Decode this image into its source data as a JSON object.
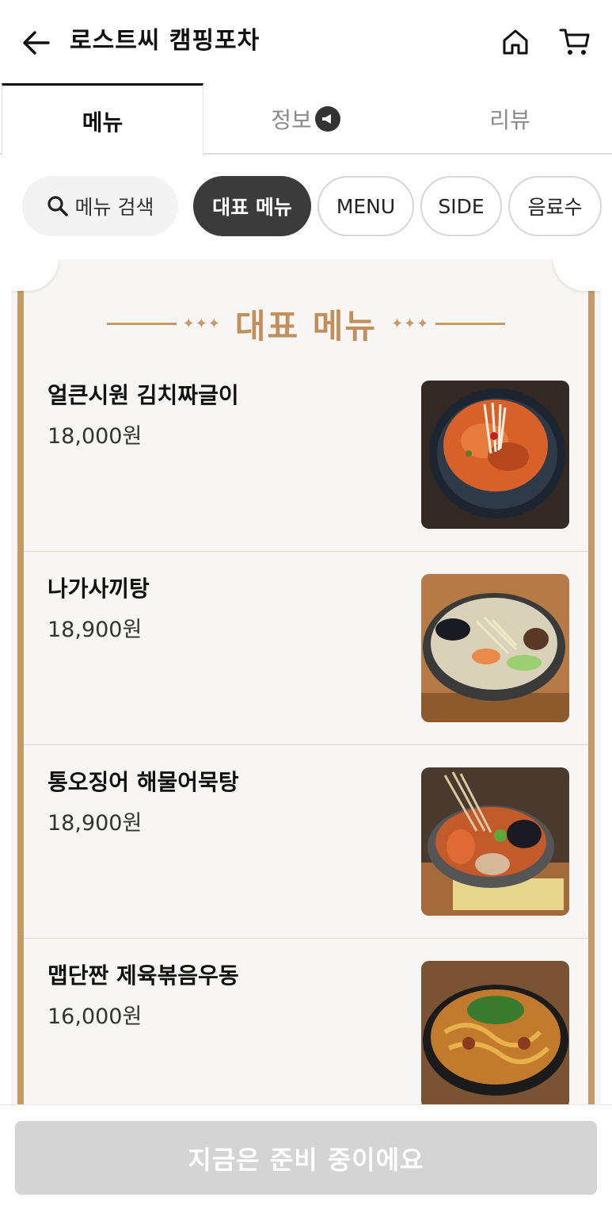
{
  "header": {
    "title": "로스트씨 캠핑포차"
  },
  "tabs": [
    {
      "label": "메뉴",
      "active": true
    },
    {
      "label": "정보",
      "active": false
    },
    {
      "label": "리뷰",
      "active": false
    }
  ],
  "chips": {
    "search_label": "메뉴 검색",
    "items": [
      {
        "label": "대표 메뉴",
        "active": true
      },
      {
        "label": "MENU",
        "active": false
      },
      {
        "label": "SIDE",
        "active": false
      },
      {
        "label": "음료수",
        "active": false
      }
    ]
  },
  "board": {
    "title": "대표 메뉴",
    "deco_left": "✦✦✦",
    "deco_right": "✦✦✦"
  },
  "menu_items": [
    {
      "name": "얼큰시원 김치짜글이",
      "price": "18,000원",
      "image": "kimchi-stew-photo"
    },
    {
      "name": "나가사끼탕",
      "price": "18,900원",
      "image": "nagasaki-soup-photo"
    },
    {
      "name": "통오징어 해물어묵탕",
      "price": "18,900원",
      "image": "seafood-fishcake-soup-photo"
    },
    {
      "name": "맵단짠 제육볶음우동",
      "price": "16,000원",
      "image": "spicy-pork-udon-photo"
    }
  ],
  "bottom": {
    "order_label": "지금은 준비 중이에요"
  },
  "colors": {
    "accent_gold": "#c49a68",
    "active_chip": "#3b3b3b",
    "disabled_button": "#d4d4d4"
  }
}
